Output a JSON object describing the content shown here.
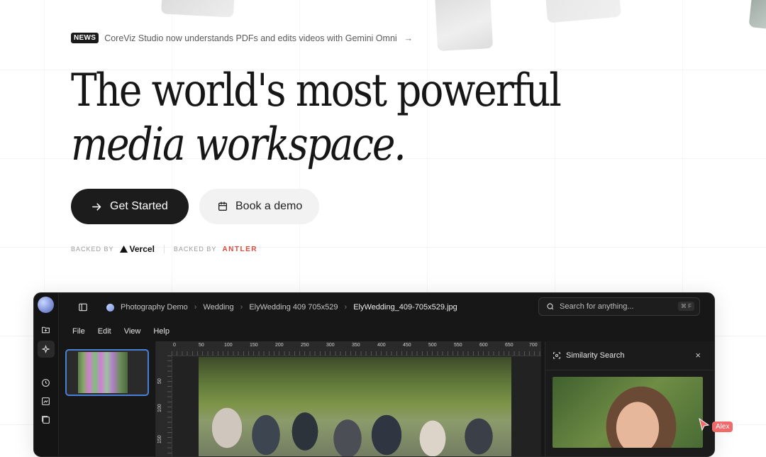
{
  "news": {
    "badge": "NEWS",
    "text": "CoreViz Studio now understands PDFs and edits videos with Gemini Omni",
    "arrow": "→"
  },
  "hero": {
    "line1": "The world's most powerful",
    "line2": "media workspace."
  },
  "cta": {
    "primary": "Get Started",
    "primary_icon": "arrow-right-icon",
    "secondary": "Book a demo",
    "secondary_icon": "calendar-icon"
  },
  "backers": [
    {
      "label": "BACKED BY",
      "brand": "Vercel"
    },
    {
      "label": "BACKED BY",
      "brand": "ANTLER"
    }
  ],
  "app": {
    "breadcrumbs": [
      "Photography Demo",
      "Wedding",
      "ElyWedding 409 705x529",
      "ElyWedding_409-705x529.jpg"
    ],
    "search_placeholder": "Search for anything...",
    "search_shortcut": "⌘ F",
    "menu": [
      "File",
      "Edit",
      "View",
      "Help"
    ],
    "ruler_x": [
      "0",
      "50",
      "100",
      "150",
      "200",
      "250",
      "300",
      "350",
      "400",
      "450",
      "500",
      "550",
      "600",
      "650",
      "700"
    ],
    "ruler_y": [
      "50",
      "100",
      "150"
    ],
    "panel_title": "Similarity Search",
    "panel_close": "×"
  },
  "collaborator": {
    "name": "Alex",
    "color": "#f06a6a"
  },
  "colors": {
    "accent": "#1c1c1c",
    "selection": "#4a7fd6",
    "antler": "#e0473b"
  }
}
